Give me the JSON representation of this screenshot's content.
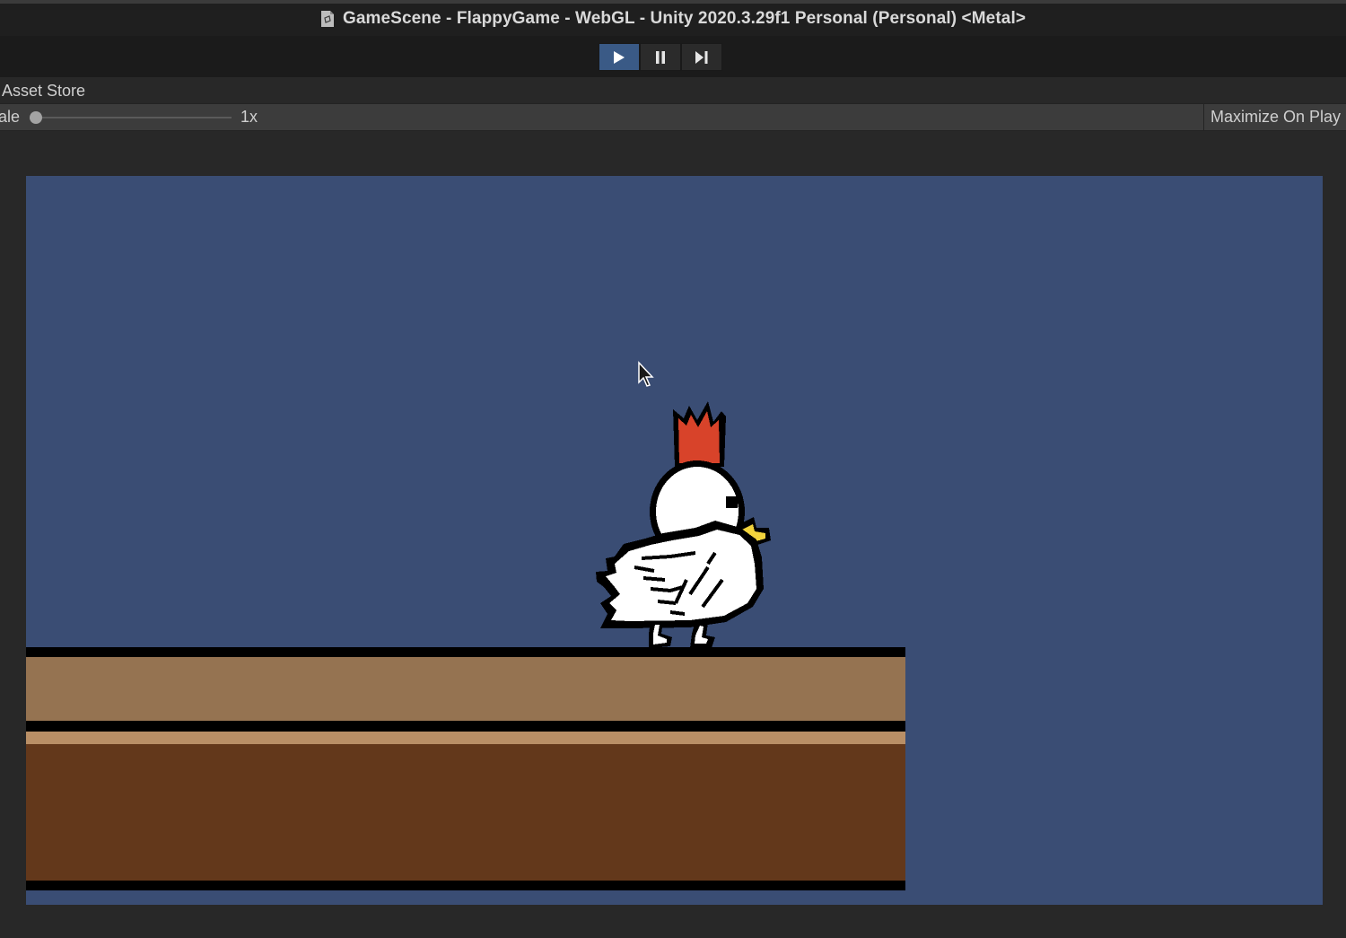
{
  "window": {
    "title": "GameScene - FlappyGame - WebGL - Unity 2020.3.29f1 Personal (Personal) <Metal>",
    "doc_icon": "unity-document-icon"
  },
  "play_controls": {
    "play_icon": "play-icon",
    "pause_icon": "pause-icon",
    "step_icon": "step-icon",
    "play_active": true
  },
  "tabs": {
    "asset_store_label": "Asset Store"
  },
  "game_toolbar": {
    "scale_label": "Scale",
    "scale_label_visible": "ale",
    "scale_value": "1x",
    "maximize_label": "Maximize On Play"
  },
  "game": {
    "sky_color": "#3a4d74",
    "ground_colors": {
      "top": "#957351",
      "stripe": "#b98f66",
      "bottom": "#63381b"
    },
    "player": "white-chicken-sprite",
    "comb_color": "#d8432a",
    "beak_color": "#f2d33c"
  },
  "cursor": "arrow-cursor",
  "colors": {
    "accent_active": "#3a5a86"
  }
}
